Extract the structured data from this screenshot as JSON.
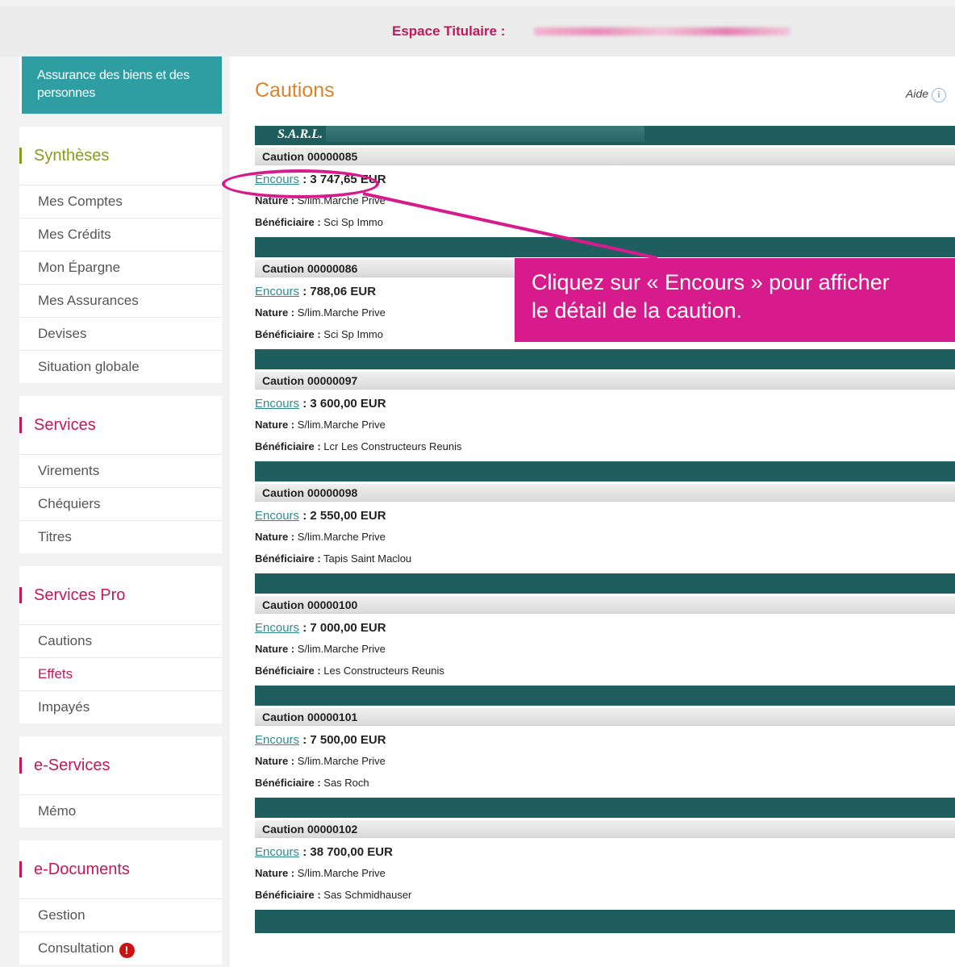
{
  "header": {
    "label": "Espace Titulaire :"
  },
  "sidebar": {
    "brand": "Assurance des biens et des personnes",
    "sections": [
      {
        "title": "Synthèses",
        "items": [
          "Mes Comptes",
          "Mes Crédits",
          "Mon Épargne",
          "Mes Assurances",
          "Devises",
          "Situation globale"
        ]
      },
      {
        "title": "Services",
        "items": [
          "Virements",
          "Chéquiers",
          "Titres"
        ]
      },
      {
        "title": "Services Pro",
        "items": [
          "Cautions",
          "Effets",
          "Impayés"
        ]
      },
      {
        "title": "e-Services",
        "items": [
          "Mémo"
        ]
      },
      {
        "title": "e-Documents",
        "items": [
          "Gestion",
          "Consultation"
        ]
      }
    ]
  },
  "main": {
    "title": "Cautions",
    "help_label": "Aide",
    "company": "S.A.R.L.",
    "cautions": [
      {
        "label": "Caution 00000085",
        "encours_label": "Encours",
        "amount": ": 3 747,65 EUR",
        "nature_label": "Nature :",
        "nature": "S/lim.Marche Prive",
        "benef_label": "Bénéficiaire :",
        "benef": "Sci Sp Immo"
      },
      {
        "label": "Caution 00000086",
        "encours_label": "Encours",
        "amount": ": 788,06 EUR",
        "nature_label": "Nature :",
        "nature": "S/lim.Marche Prive",
        "benef_label": "Bénéficiaire :",
        "benef": "Sci Sp Immo"
      },
      {
        "label": "Caution 00000097",
        "encours_label": "Encours",
        "amount": ": 3 600,00 EUR",
        "nature_label": "Nature :",
        "nature": "S/lim.Marche Prive",
        "benef_label": "Bénéficiaire :",
        "benef": "Lcr Les Constructeurs Reunis"
      },
      {
        "label": "Caution 00000098",
        "encours_label": "Encours",
        "amount": ": 2 550,00 EUR",
        "nature_label": "Nature :",
        "nature": "S/lim.Marche Prive",
        "benef_label": "Bénéficiaire :",
        "benef": "Tapis Saint Maclou"
      },
      {
        "label": "Caution 00000100",
        "encours_label": "Encours",
        "amount": ": 7 000,00 EUR",
        "nature_label": "Nature :",
        "nature": "S/lim.Marche Prive",
        "benef_label": "Bénéficiaire :",
        "benef": "Les Constructeurs Reunis"
      },
      {
        "label": "Caution 00000101",
        "encours_label": "Encours",
        "amount": ": 7 500,00 EUR",
        "nature_label": "Nature :",
        "nature": "S/lim.Marche Prive",
        "benef_label": "Bénéficiaire :",
        "benef": "Sas Roch"
      },
      {
        "label": "Caution 00000102",
        "encours_label": "Encours",
        "amount": ": 38 700,00 EUR",
        "nature_label": "Nature :",
        "nature": "S/lim.Marche Prive",
        "benef_label": "Bénéficiaire :",
        "benef": "Sas Schmidhauser"
      }
    ]
  },
  "callout": {
    "line1": "Cliquez sur « Encours » pour afficher",
    "line2": "le détail de la caution."
  },
  "colors": {
    "accent_pink": "#c2185b",
    "teal_dark": "#1e5e5f",
    "teal_brand": "#2f9ea3",
    "title_orange": "#d9842a",
    "callout_magenta": "#d81b8c"
  },
  "icons": {
    "help": "info-icon",
    "alert": "alert-icon"
  }
}
